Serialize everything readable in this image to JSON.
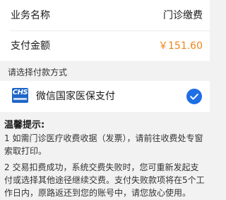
{
  "order": {
    "business_label": "业务名称",
    "business_value": "门诊缴费",
    "amount_label": "支付金额",
    "amount_value": "￥151.60",
    "amount_color": "#f08519"
  },
  "payment": {
    "section_title": "请选择付款方式",
    "method_name": "微信国家医保支付",
    "method_logo_text": "CHS",
    "method_icon": "national-medical-insurance-logo",
    "selected": true,
    "accent_color": "#1e6ee6"
  },
  "notice": {
    "title": "温馨提示:",
    "items": [
      "1 如需门诊医疗收费收据（发票），请前往收费处专窗索取打印。",
      "2 交易扣费成功，系统交费失败时，您可重新发起支付或选择其他途径继续交费。支付失败款项将在5个工作日内，原路返还到您的账号中，请您放心使用。"
    ]
  }
}
